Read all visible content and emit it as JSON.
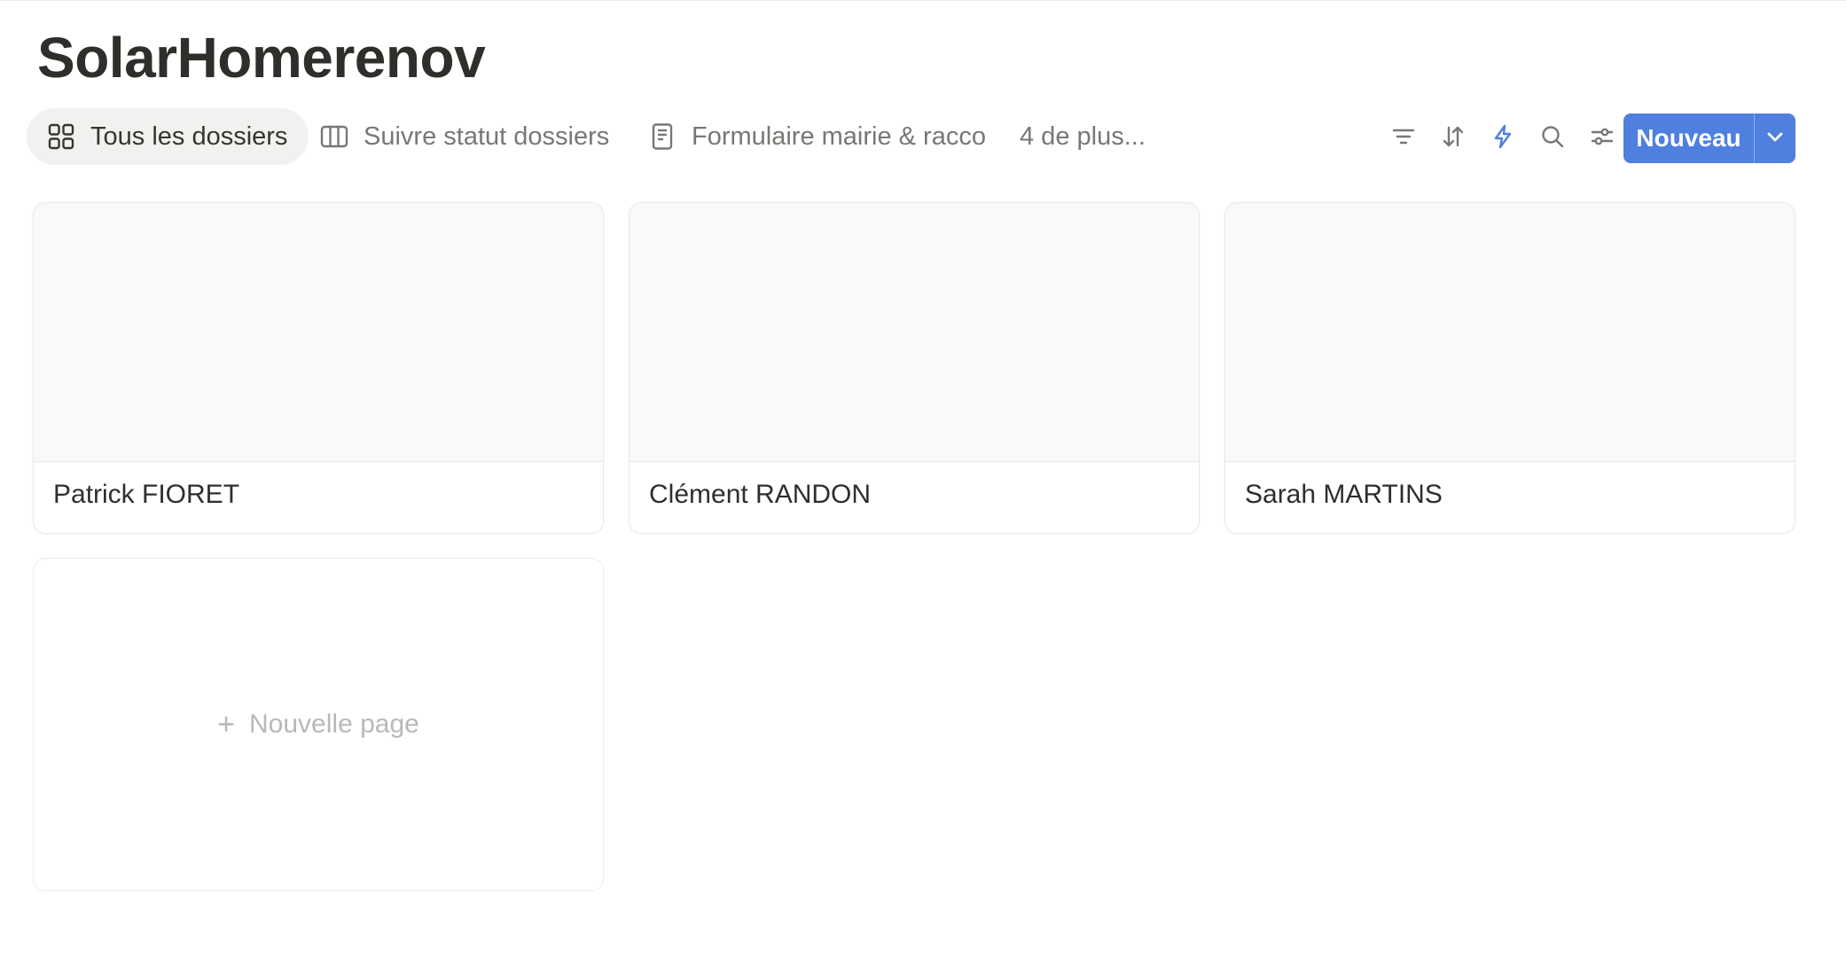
{
  "page": {
    "title": "SolarHomerenov"
  },
  "tabs": [
    {
      "label": "Tous les dossiers",
      "icon": "gallery-grid-icon",
      "active": true
    },
    {
      "label": "Suivre statut dossiers",
      "icon": "board-columns-icon",
      "active": false
    },
    {
      "label": "Formulaire mairie & racco",
      "icon": "form-document-icon",
      "active": false
    }
  ],
  "more_views_label": "4 de plus...",
  "tools": [
    {
      "icon": "filter-icon"
    },
    {
      "icon": "sort-icon"
    },
    {
      "icon": "automation-bolt-icon"
    },
    {
      "icon": "search-icon"
    },
    {
      "icon": "view-settings-icon"
    }
  ],
  "new_button": {
    "label": "Nouveau",
    "dropdown_icon": "chevron-down-icon"
  },
  "cards": [
    {
      "title": "Patrick FIORET"
    },
    {
      "title": "Clément RANDON"
    },
    {
      "title": "Sarah MARTINS"
    }
  ],
  "new_page": {
    "label": "Nouvelle page"
  },
  "colors": {
    "accent": "#4f7fdf",
    "bolt": "#4f7fdf",
    "active_tab_bg": "#f1f1ef",
    "card_cover": "#f9f9f8"
  }
}
